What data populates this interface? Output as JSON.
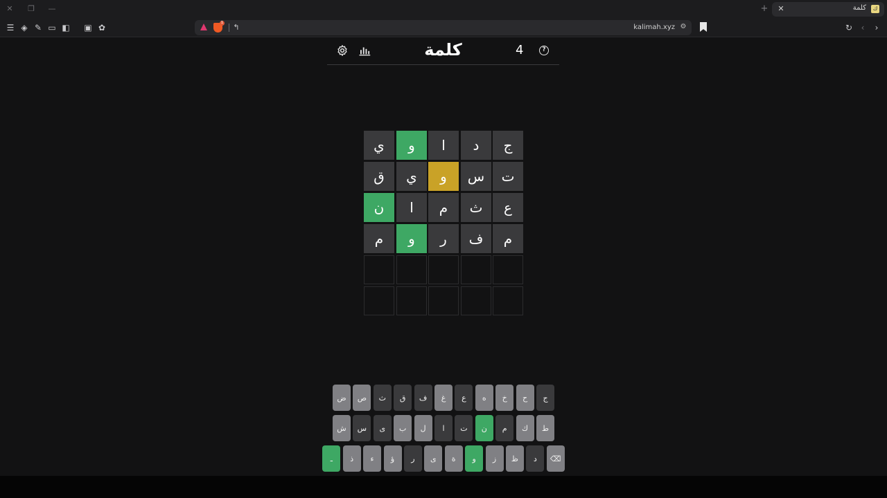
{
  "browser": {
    "tab": {
      "title": "كلمة",
      "favicon": "ك"
    },
    "url": "kalimah.xyz",
    "shield_count": "1"
  },
  "header": {
    "title": "كلمة",
    "count": "4"
  },
  "board": [
    [
      {
        "l": "ج",
        "s": "filled"
      },
      {
        "l": "د",
        "s": "filled"
      },
      {
        "l": "ا",
        "s": "filled"
      },
      {
        "l": "و",
        "s": "correct"
      },
      {
        "l": "ي",
        "s": "filled"
      }
    ],
    [
      {
        "l": "ت",
        "s": "filled"
      },
      {
        "l": "س",
        "s": "filled"
      },
      {
        "l": "و",
        "s": "present"
      },
      {
        "l": "ي",
        "s": "filled"
      },
      {
        "l": "ق",
        "s": "filled"
      }
    ],
    [
      {
        "l": "ع",
        "s": "filled"
      },
      {
        "l": "ث",
        "s": "filled"
      },
      {
        "l": "م",
        "s": "filled"
      },
      {
        "l": "ا",
        "s": "filled"
      },
      {
        "l": "ن",
        "s": "correct"
      }
    ],
    [
      {
        "l": "م",
        "s": "filled"
      },
      {
        "l": "ف",
        "s": "filled"
      },
      {
        "l": "ر",
        "s": "filled"
      },
      {
        "l": "و",
        "s": "correct"
      },
      {
        "l": "م",
        "s": "filled"
      }
    ],
    [
      {
        "l": "",
        "s": "empty"
      },
      {
        "l": "",
        "s": "empty"
      },
      {
        "l": "",
        "s": "empty"
      },
      {
        "l": "",
        "s": "empty"
      },
      {
        "l": "",
        "s": "empty"
      }
    ],
    [
      {
        "l": "",
        "s": "empty"
      },
      {
        "l": "",
        "s": "empty"
      },
      {
        "l": "",
        "s": "empty"
      },
      {
        "l": "",
        "s": "empty"
      },
      {
        "l": "",
        "s": "empty"
      }
    ]
  ],
  "keyboard": [
    [
      {
        "l": "ج",
        "s": "absent"
      },
      {
        "l": "ح",
        "s": "unused"
      },
      {
        "l": "خ",
        "s": "unused"
      },
      {
        "l": "ه",
        "s": "unused"
      },
      {
        "l": "ع",
        "s": "absent"
      },
      {
        "l": "غ",
        "s": "unused"
      },
      {
        "l": "ف",
        "s": "absent"
      },
      {
        "l": "ق",
        "s": "absent"
      },
      {
        "l": "ث",
        "s": "absent"
      },
      {
        "l": "ص",
        "s": "unused"
      },
      {
        "l": "ض",
        "s": "unused"
      }
    ],
    [
      {
        "l": "ط",
        "s": "unused"
      },
      {
        "l": "ك",
        "s": "unused"
      },
      {
        "l": "م",
        "s": "absent"
      },
      {
        "l": "ن",
        "s": "correct"
      },
      {
        "l": "ت",
        "s": "absent"
      },
      {
        "l": "ا",
        "s": "absent"
      },
      {
        "l": "ل",
        "s": "unused"
      },
      {
        "l": "ب",
        "s": "unused"
      },
      {
        "l": "ى",
        "s": "absent"
      },
      {
        "l": "س",
        "s": "absent"
      },
      {
        "l": "ش",
        "s": "unused"
      }
    ],
    [
      {
        "l": "⌫",
        "s": "unused",
        "name": "backspace-key"
      },
      {
        "l": "د",
        "s": "absent"
      },
      {
        "l": "ظ",
        "s": "unused"
      },
      {
        "l": "ز",
        "s": "unused"
      },
      {
        "l": "و",
        "s": "correct"
      },
      {
        "l": "ة",
        "s": "unused"
      },
      {
        "l": "ى",
        "s": "unused"
      },
      {
        "l": "ر",
        "s": "absent"
      },
      {
        "l": "ؤ",
        "s": "unused"
      },
      {
        "l": "ء",
        "s": "unused"
      },
      {
        "l": "ذ",
        "s": "unused"
      },
      {
        "l": "ـ",
        "s": "correct",
        "name": "enter-key"
      }
    ]
  ],
  "colors": {
    "correct": "#3ea864",
    "present": "#c9a227",
    "absent": "#3a3a3c",
    "unused": "#808084",
    "background": "#121213"
  }
}
